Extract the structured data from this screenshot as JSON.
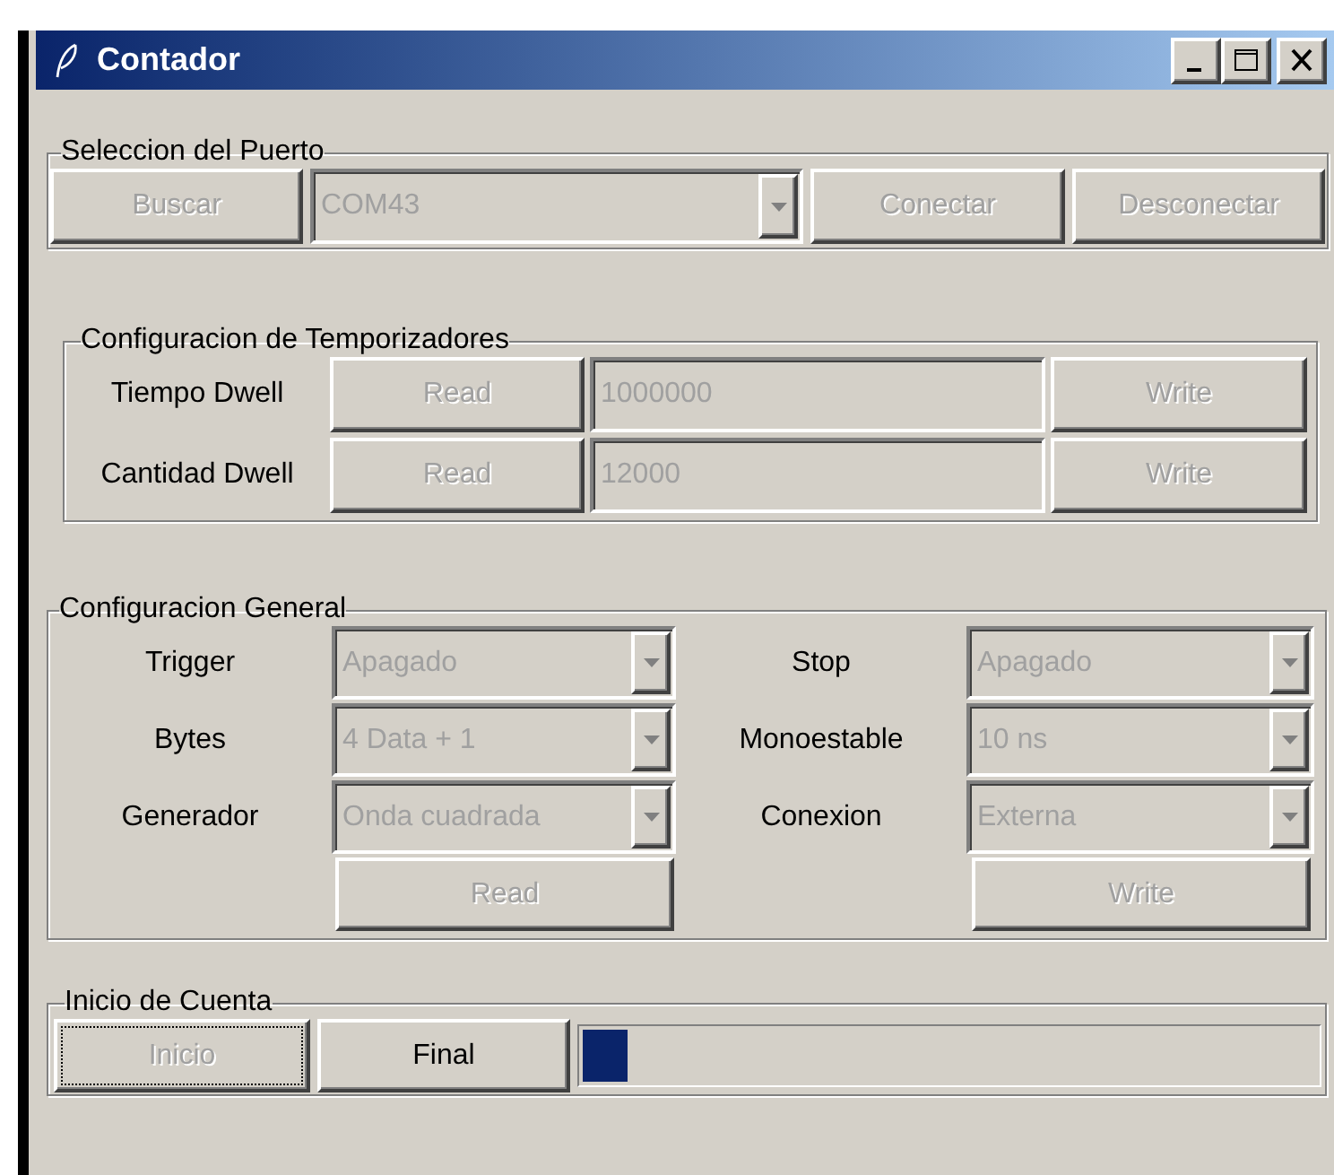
{
  "window": {
    "title": "Contador"
  },
  "port_group": {
    "title": "Seleccion del Puerto",
    "search_button": {
      "label": "Buscar",
      "disabled": true
    },
    "port_combo": {
      "value": "COM43",
      "disabled": true
    },
    "connect_button": {
      "label": "Conectar",
      "disabled": true
    },
    "disconnect_button": {
      "label": "Desconectar",
      "disabled": true
    }
  },
  "timers_group": {
    "title": "Configuracion de Temporizadores",
    "rows": [
      {
        "label": "Tiempo Dwell",
        "read_button": {
          "label": "Read",
          "disabled": true
        },
        "entry": {
          "value": "1000000",
          "disabled": true
        },
        "write_button": {
          "label": "Write",
          "disabled": true
        }
      },
      {
        "label": "Cantidad Dwell",
        "read_button": {
          "label": "Read",
          "disabled": true
        },
        "entry": {
          "value": "12000",
          "disabled": true
        },
        "write_button": {
          "label": "Write",
          "disabled": true
        }
      }
    ]
  },
  "general_group": {
    "title": "Configuracion General",
    "rows": [
      {
        "left": {
          "label": "Trigger",
          "value": "Apagado",
          "disabled": true
        },
        "right": {
          "label": "Stop",
          "value": "Apagado",
          "disabled": true
        }
      },
      {
        "left": {
          "label": "Bytes",
          "value": "4 Data + 1",
          "disabled": true
        },
        "right": {
          "label": "Monoestable",
          "value": "10 ns",
          "disabled": true
        }
      },
      {
        "left": {
          "label": "Generador",
          "value": "Onda cuadrada",
          "disabled": true
        },
        "right": {
          "label": "Conexion",
          "value": "Externa",
          "disabled": true
        }
      }
    ],
    "read_button": {
      "label": "Read",
      "disabled": true
    },
    "write_button": {
      "label": "Write",
      "disabled": true
    }
  },
  "count_group": {
    "title": "Inicio de Cuenta",
    "start_button": {
      "label": "Inicio",
      "disabled": true,
      "focused": true
    },
    "final_button": {
      "label": "Final",
      "disabled": false,
      "focused": false
    },
    "progress": {
      "level": 0.06
    }
  }
}
